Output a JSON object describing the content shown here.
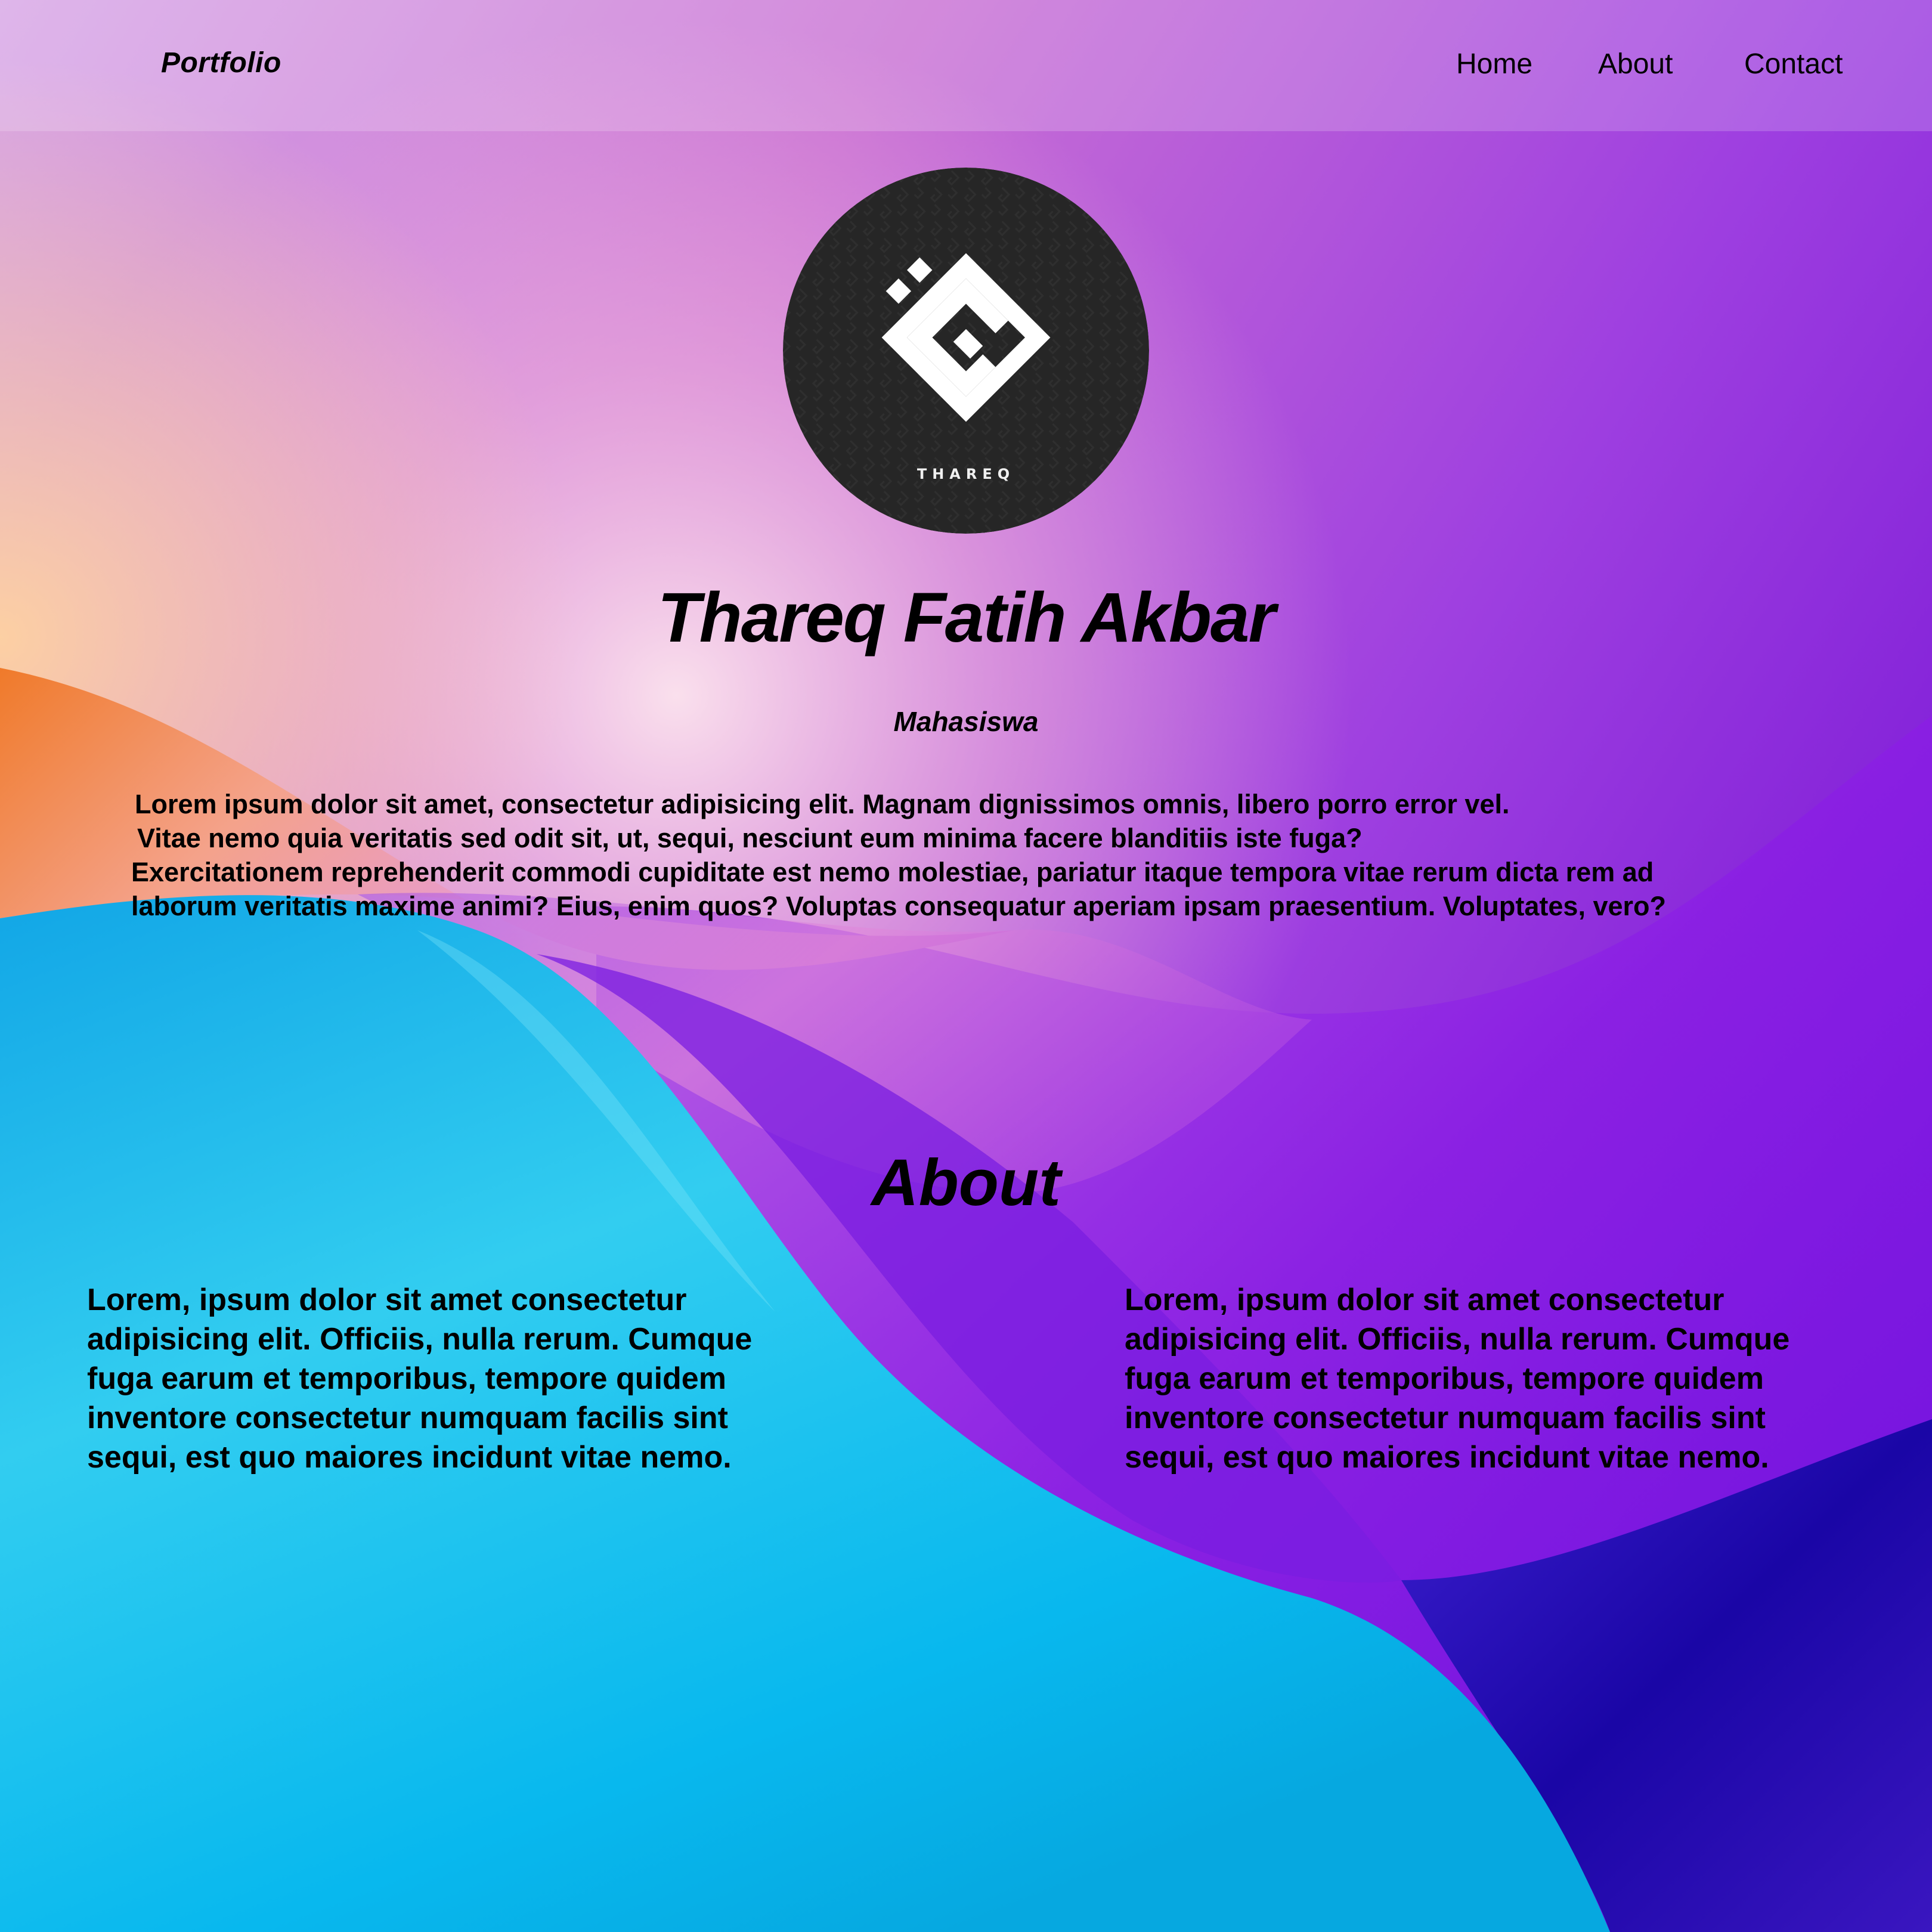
{
  "navbar": {
    "brand": "Portfolio",
    "links": [
      {
        "label": "Home"
      },
      {
        "label": "About"
      },
      {
        "label": "Contact"
      }
    ]
  },
  "hero": {
    "avatar_caption": "THAREQ",
    "name": "Thareq Fatih Akbar",
    "role": "Mahasiswa",
    "paragraph_lines": [
      "Lorem ipsum dolor sit amet, consectetur adipisicing elit. Magnam dignissimos omnis, libero porro error vel.",
      "Vitae nemo quia veritatis sed odit sit, ut, sequi, nesciunt eum minima facere blanditiis iste fuga?",
      "Exercitationem reprehenderit commodi cupiditate est nemo molestiae, pariatur itaque tempora vitae rerum dicta rem ad",
      "laborum veritatis maxime animi? Eius, enim quos? Voluptas consequatur aperiam ipsam praesentium. Voluptates, vero?"
    ]
  },
  "about": {
    "title": "About",
    "left_text": "Lorem, ipsum dolor sit amet consectetur adipisicing elit. Officiis, nulla rerum. Cumque fuga earum et temporibus, tempore quidem inventore consectetur numquam facilis sint sequi, est quo maiores incidunt vitae nemo.",
    "right_text": "Lorem, ipsum dolor sit amet consectetur adipisicing elit. Officiis, nulla rerum. Cumque fuga earum et temporibus, tempore quidem inventore consectetur numquam facilis sint sequi, est quo maiores incidunt vitae nemo."
  },
  "colors": {
    "background_purple": "#9a2ee0",
    "background_cyan": "#16b8ec",
    "background_orange": "#f08a3a",
    "background_navy": "#2a0fa8",
    "avatar_dark": "#262626",
    "text": "#000000"
  },
  "icons": {
    "avatar": "kufic-calligraphy-logo"
  }
}
